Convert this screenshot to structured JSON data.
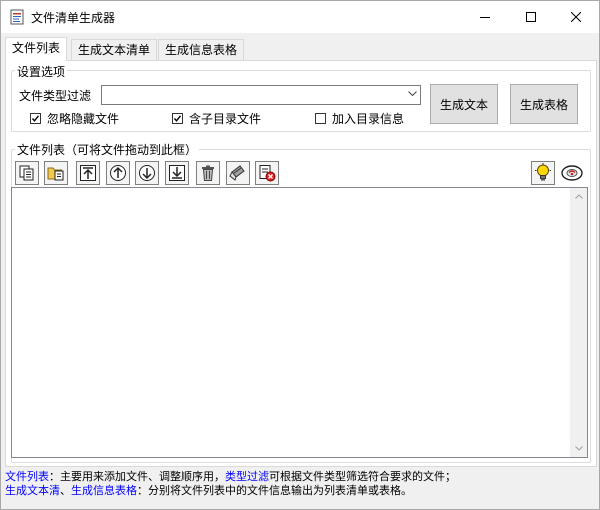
{
  "window": {
    "title": "文件清单生成器"
  },
  "tabs": [
    {
      "label": "文件列表",
      "active": true
    },
    {
      "label": "生成文本清单",
      "active": false
    },
    {
      "label": "生成信息表格",
      "active": false
    }
  ],
  "settings": {
    "group_label": "设置选项",
    "filter_label": "文件类型过滤",
    "filter_value": "",
    "ignore_hidden": {
      "label": "忽略隐藏文件",
      "checked": true
    },
    "include_subdirs": {
      "label": "含子目录文件",
      "checked": true
    },
    "add_dir_info": {
      "label": "加入目录信息",
      "checked": false
    },
    "gen_text_label": "生成文本",
    "gen_table_label": "生成表格"
  },
  "filelist": {
    "group_label": "文件列表（可将文件拖动到此框）",
    "toolbar_icons": [
      "copy-files-icon",
      "add-folder-icon",
      "move-top-icon",
      "move-up-icon",
      "move-down-icon",
      "move-bottom-icon",
      "delete-icon",
      "clear-icon",
      "remove-invalid-icon",
      "tip-bulb-icon",
      "about-eye-icon"
    ],
    "items": []
  },
  "help": {
    "line1_link1": "文件列表",
    "line1_text1": "：主要用来添加文件、调整顺序用，",
    "line1_link2": "类型过滤",
    "line1_text2": "可根据文件类型筛选符合要求的文件；",
    "line2_link1": "生成文本清",
    "line2_sep": "、",
    "line2_link2": "生成信息表格",
    "line2_text": "：分别将文件列表中的文件信息输出为列表清单或表格。"
  },
  "colors": {
    "link": "#0000ff",
    "bulb": "#ffd800",
    "delete_red": "#e02020"
  }
}
